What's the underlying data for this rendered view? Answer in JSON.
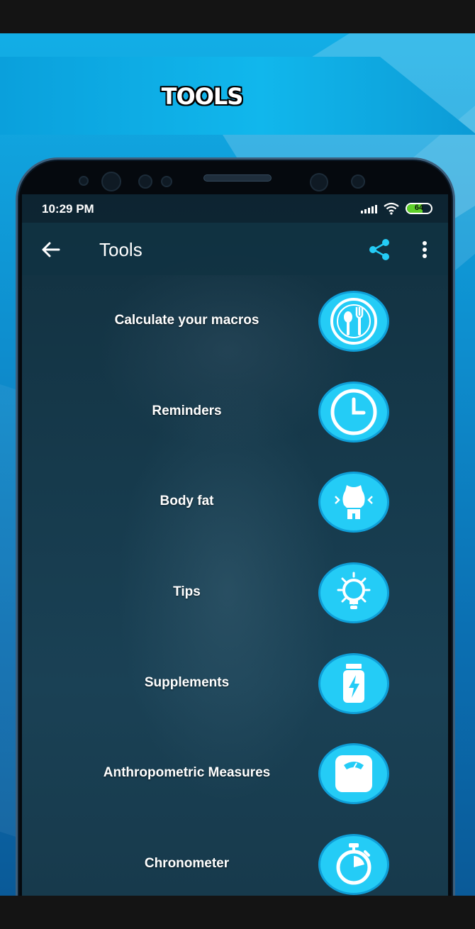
{
  "banner": {
    "title": "TOOLS"
  },
  "status_bar": {
    "time": "10:29 PM",
    "battery": "64"
  },
  "app_bar": {
    "title": "Tools"
  },
  "tools": [
    {
      "label": "Calculate your macros",
      "icon": "plate-cutlery-icon"
    },
    {
      "label": "Reminders",
      "icon": "clock-icon"
    },
    {
      "label": "Body fat",
      "icon": "body-fat-icon"
    },
    {
      "label": "Tips",
      "icon": "lightbulb-icon"
    },
    {
      "label": "Supplements",
      "icon": "supplement-jar-icon"
    },
    {
      "label": "Anthropometric Measures",
      "icon": "scale-icon"
    },
    {
      "label": "Chronometer",
      "icon": "stopwatch-icon"
    }
  ],
  "colors": {
    "accent": "#24ccf6",
    "app_bar": "#113242",
    "banner": "#0aa0dc"
  }
}
